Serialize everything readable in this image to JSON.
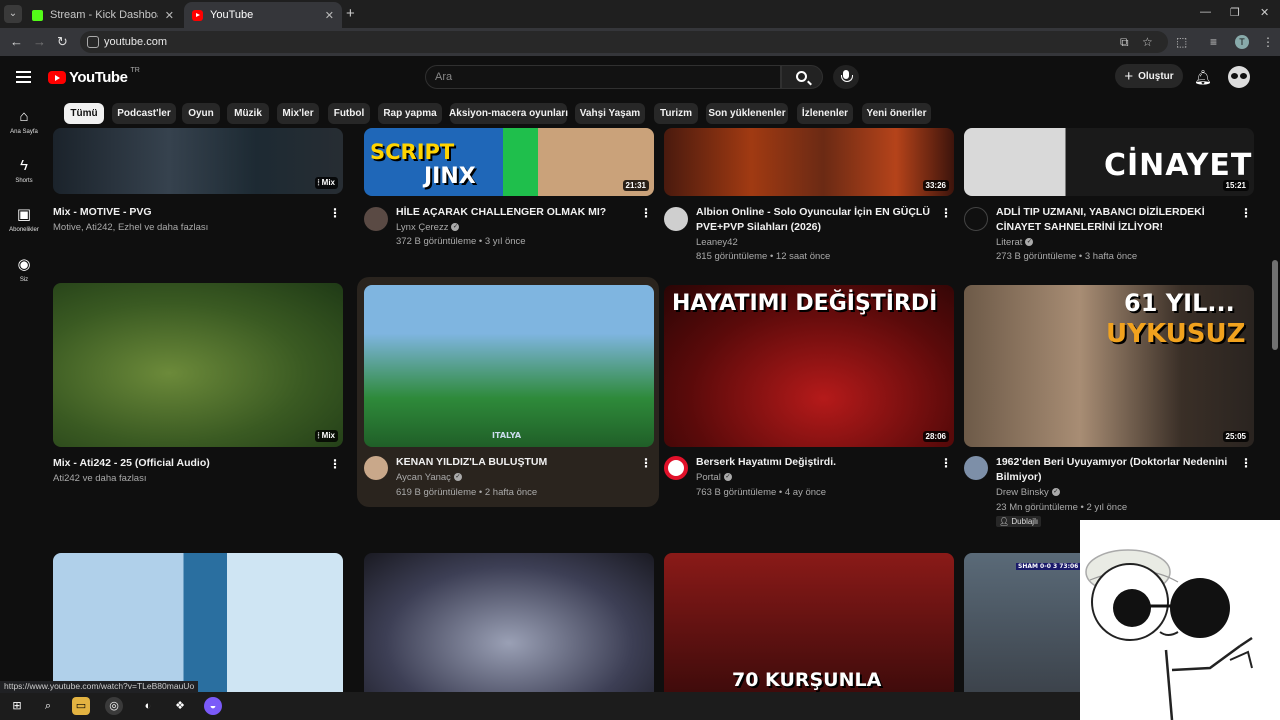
{
  "browser": {
    "tabs": [
      {
        "title": "Stream - Kick Dashboard"
      },
      {
        "title": "YouTube"
      }
    ],
    "url": "youtube.com",
    "profile_initial": "T",
    "status_url": "https://www.youtube.com/watch?v=TLeB80mauUo"
  },
  "yt": {
    "logo_text": "YouTube",
    "logo_region": "TR",
    "search_placeholder": "Ara",
    "create_label": "Oluştur"
  },
  "sidebar": {
    "items": [
      {
        "label": "Ana Sayfa",
        "icon": "home-icon"
      },
      {
        "label": "Shorts",
        "icon": "shorts-icon"
      },
      {
        "label": "Abonelikler",
        "icon": "subscriptions-icon"
      },
      {
        "label": "Siz",
        "icon": "you-icon"
      }
    ]
  },
  "chips": [
    "Tümü",
    "Podcast'ler",
    "Oyun",
    "Müzik",
    "Mix'ler",
    "Futbol",
    "Rap yapma",
    "Aksiyon-macera oyunları",
    "Vahşi Yaşam",
    "Turizm",
    "Son yüklenenler",
    "İzlenenler",
    "Yeni öneriler"
  ],
  "videos": [
    {
      "title": "Mix - MOTIVE - PVG",
      "channel": "Motive, Ati242, Ezhel ve daha fazlası",
      "meta": "",
      "duration": "Mix"
    },
    {
      "title": "HİLE AÇARAK CHALLENGER OLMAK MI?",
      "channel": "Lynx Çerezz",
      "meta": "372 B görüntüleme • 3 yıl önce",
      "duration": "21:31",
      "thumb_text1": "SCRIPT",
      "thumb_text2": "JINX"
    },
    {
      "title": "Albion Online - Solo Oyuncular İçin EN GÜÇLÜ PVE+PVP Silahları (2026)",
      "channel": "Leaney42",
      "meta": "815 görüntüleme • 12 saat önce",
      "duration": "33:26"
    },
    {
      "title": "ADLİ TIP UZMANI, YABANCI DİZİLERDEKİ CİNAYET SAHNELERİNİ İZLİYOR!",
      "channel": "Literat",
      "meta": "273 B görüntüleme • 3 hafta önce",
      "duration": "15:21",
      "thumb_text1": "CİNAYET"
    },
    {
      "title": "Mix - Ati242 - 25 (Official Audio)",
      "channel": "Ati242 ve daha fazlası",
      "meta": "",
      "duration": "Mix"
    },
    {
      "title": "KENAN YILDIZ'LA BULUŞTUM",
      "channel": "Aycan Yanaç",
      "meta": "619 B görüntüleme • 2 hafta önce",
      "duration": "",
      "thumb_text1": "ITALYA"
    },
    {
      "title": "Berserk Hayatımı Değiştirdi.",
      "channel": "Portal",
      "meta": "763 B görüntüleme • 4 ay önce",
      "duration": "28:06",
      "thumb_text1": "HAYATIMI DEĞİŞTİRDİ"
    },
    {
      "title": "1962'den Beri Uyuyamıyor (Doktorlar Nedenini Bilmiyor)",
      "channel": "Drew Binsky",
      "meta": "23 Mn görüntüleme • 2 yıl önce",
      "duration": "25:05",
      "badge": "Dublajlı",
      "thumb_text1": "61 YIL...",
      "thumb_text2": "UYKUSUZ"
    },
    {
      "title": "",
      "channel": "",
      "meta": "",
      "duration": ""
    },
    {
      "title": "",
      "channel": "",
      "meta": "",
      "duration": ""
    },
    {
      "title": "",
      "channel": "",
      "meta": "",
      "duration": "",
      "thumb_text1": "70 KURŞUNLA"
    },
    {
      "title": "",
      "channel": "",
      "meta": "",
      "duration": "",
      "thumb_text1": "SHAM 0-0 3 73:06"
    }
  ],
  "colors": {
    "background": "#0f0f0f",
    "brand_red": "#ff0000",
    "hover_card": "#2a241e",
    "chip_active": "#f1f1f1",
    "chip": "#272727"
  }
}
